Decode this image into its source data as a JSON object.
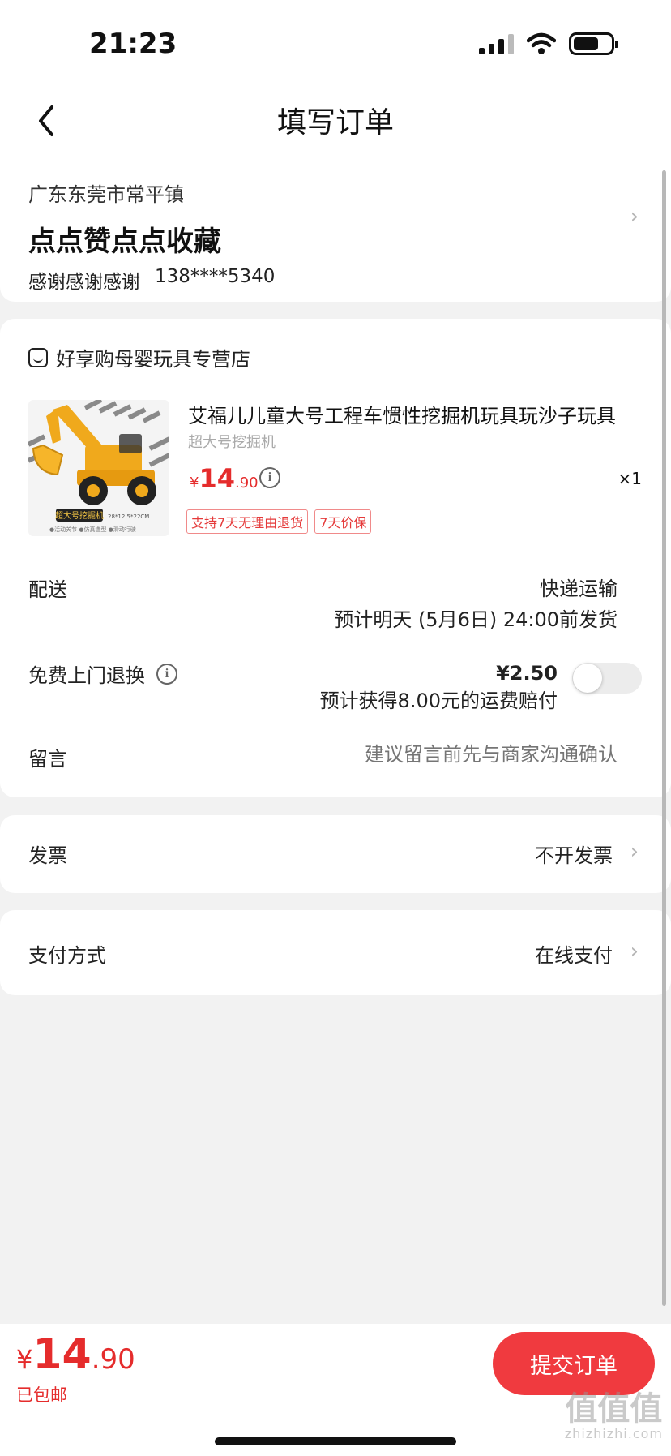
{
  "status_bar": {
    "time": "21:23"
  },
  "nav": {
    "title": "填写订单"
  },
  "address": {
    "region": "广东东莞市常平镇",
    "name": "点点赞点点收藏",
    "recipient": "感谢感谢感谢",
    "phone": "138****5340"
  },
  "shop": {
    "name": "好享购母婴玩具专营店"
  },
  "product": {
    "title": "艾福儿儿童大号工程车惯性挖掘机玩具玩沙子玩具",
    "spec": "超大号挖掘机",
    "price_symbol": "¥",
    "price_int": "14",
    "price_dec": ".90",
    "quantity": "×1",
    "tags": [
      "支持7天无理由退货",
      "7天价保"
    ],
    "image_label": "超大号挖掘机",
    "image_size": "28*12.5*22CM",
    "image_features": "●活动关节 ●仿真造型 ●滑动行驶"
  },
  "delivery": {
    "label": "配送",
    "method": "快递运输",
    "eta": "预计明天 (5月6日) 24:00前发货"
  },
  "return_service": {
    "label": "免费上门退换",
    "price": "¥2.50",
    "note": "预计获得8.00元的运费赔付",
    "enabled": false
  },
  "message": {
    "label": "留言",
    "placeholder": "建议留言前先与商家沟通确认"
  },
  "invoice": {
    "label": "发票",
    "value": "不开发票"
  },
  "payment": {
    "label": "支付方式",
    "value": "在线支付"
  },
  "footer": {
    "total_symbol": "¥",
    "total_int": "14",
    "total_dec": ".90",
    "shipping": "已包邮",
    "submit_label": "提交订单"
  },
  "watermark": {
    "logo": "值值值",
    "site": "zhizhizhi.com"
  },
  "colors": {
    "accent": "#f03a3f",
    "price": "#e52c2c",
    "background": "#f2f2f2"
  }
}
